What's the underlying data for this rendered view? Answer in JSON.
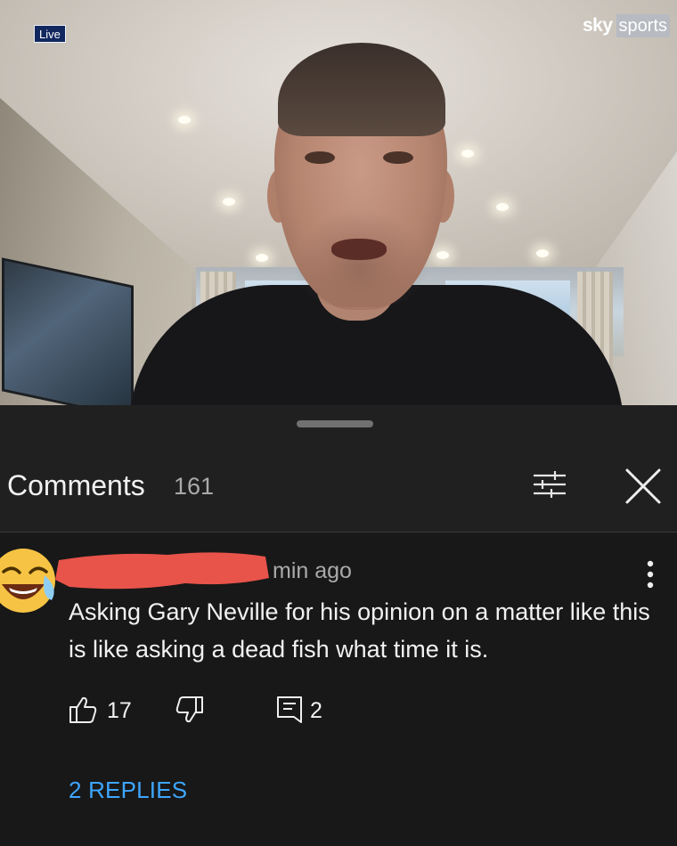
{
  "video": {
    "live_badge": "Live",
    "broadcaster": {
      "sky": "sky",
      "sports": "sports"
    }
  },
  "comments": {
    "title": "Comments",
    "count": "161",
    "comment": {
      "time": "min ago",
      "text": "Asking Gary Neville for his opinion on a matter like this is like asking a dead fish what time it is.",
      "likes": "17",
      "replies_count": "2",
      "view_replies_label": "2 REPLIES",
      "avatar_icon": "laughing-crying-emoji-icon"
    }
  },
  "colors": {
    "sheet_header": "#202020",
    "comment_bg": "#181818",
    "link_blue": "#3ea6ff",
    "redaction": "#e8534a"
  }
}
